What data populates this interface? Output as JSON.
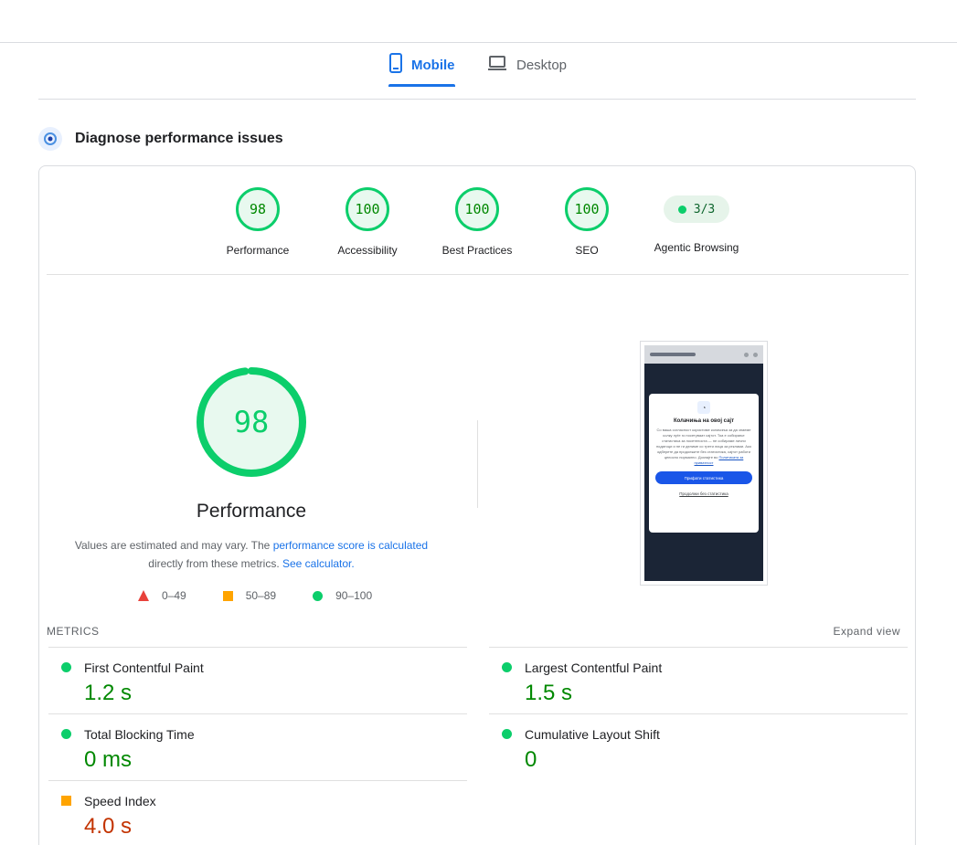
{
  "tabs": [
    {
      "label": "Mobile",
      "active": true,
      "icon": "smartphone-icon"
    },
    {
      "label": "Desktop",
      "active": false,
      "icon": "laptop-icon"
    }
  ],
  "diagnose": {
    "title": "Diagnose performance issues",
    "icon": "gauge-icon"
  },
  "categories": [
    {
      "label": "Performance",
      "score": "98"
    },
    {
      "label": "Accessibility",
      "score": "100"
    },
    {
      "label": "Best Practices",
      "score": "100"
    },
    {
      "label": "SEO",
      "score": "100"
    },
    {
      "label": "Agentic Browsing",
      "score": "3/3"
    }
  ],
  "performance": {
    "score": "98",
    "score_fraction": 0.98,
    "title": "Performance",
    "note_prefix": "Values are estimated and may vary. The",
    "note_link": "performance score is calculated",
    "note_middle": "directly from these metrics.",
    "note_link2": "See calculator."
  },
  "legend": [
    {
      "range": "0–49",
      "shape": "triangle",
      "color": "#e8423b"
    },
    {
      "range": "50–89",
      "shape": "square",
      "color": "#ffa400"
    },
    {
      "range": "90–100",
      "shape": "circle",
      "color": "#0cce6b"
    }
  ],
  "screenshot": {
    "modal_icon": "cookie-icon",
    "modal_title": "Колачиња на овој сајт",
    "modal_text": "Со ваша согласност користиме колачиња за да знаеме колку луѓе го посетуваат сајтот. Тоа е собирање статистика за посетеноста — не собираме лични податоци и не ги делиме со трети лица за реклами. Ако одберете да продолжите без статистика, сајтот работи целосно нормално. Дознајте во",
    "modal_link": "Политиката за приватност",
    "accept_label": "Прифати статистика",
    "decline_label": "Продолжи без статистика"
  },
  "metrics": {
    "heading": "METRICS",
    "expand_label": "Expand view",
    "items": [
      {
        "name": "First Contentful Paint",
        "value": "1.2 s",
        "rating": "good"
      },
      {
        "name": "Largest Contentful Paint",
        "value": "1.5 s",
        "rating": "good"
      },
      {
        "name": "Total Blocking Time",
        "value": "0 ms",
        "rating": "good"
      },
      {
        "name": "Cumulative Layout Shift",
        "value": "0",
        "rating": "good"
      },
      {
        "name": "Speed Index",
        "value": "4.0 s",
        "rating": "average"
      }
    ]
  },
  "colors": {
    "accent": "#1a73e8",
    "pass": "#0cce6b",
    "average": "#ffa400",
    "fail": "#e8423b"
  }
}
